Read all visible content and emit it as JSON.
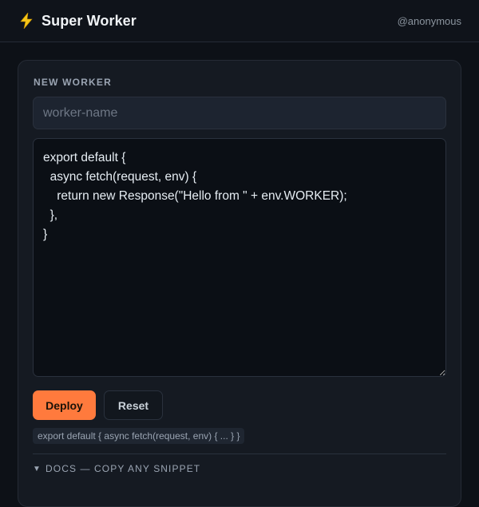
{
  "app": {
    "title": "Super Worker",
    "user": "@anonymous",
    "icon": "lightning-bolt-icon",
    "accent": "#ff7a3d"
  },
  "worker_form": {
    "section_label": "NEW WORKER",
    "name_placeholder": "worker-name",
    "name_value": "",
    "code": "export default {\n  async fetch(request, env) {\n    return new Response(\"Hello from \" + env.WORKER);\n  },\n}",
    "deploy_label": "Deploy",
    "reset_label": "Reset",
    "snippet_preview": "export default { async fetch(request, env) { ... } }"
  },
  "docs": {
    "toggle_icon": "triangle-down-icon",
    "label": "DOCS — COPY ANY SNIPPET"
  }
}
